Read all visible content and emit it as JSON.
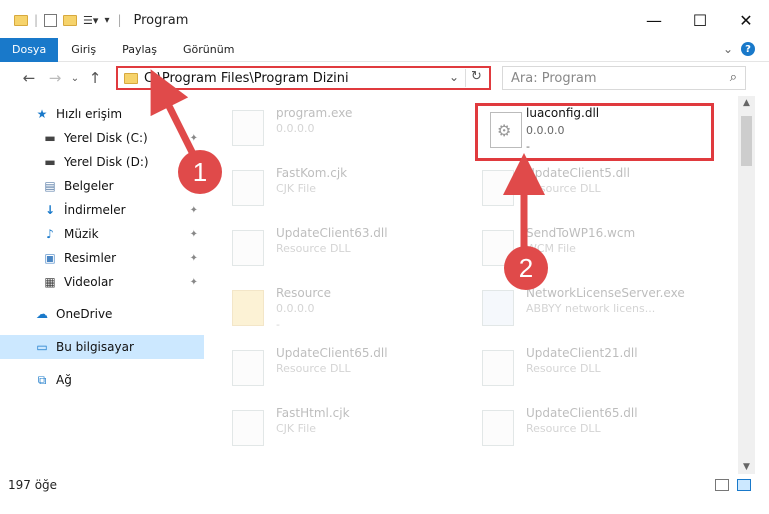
{
  "window": {
    "title": "Program",
    "minimize": "—",
    "maximize": "☐",
    "close": "✕"
  },
  "ribbon": {
    "tabs": [
      "Dosya",
      "Giriş",
      "Paylaş",
      "Görünüm"
    ],
    "expand": "⌄",
    "help": "?"
  },
  "nav": {
    "back": "←",
    "forward": "→",
    "recent": "⌄",
    "up": "↑",
    "address": "C:\\Program Files\\Program Dizini",
    "refresh": "↻",
    "search_placeholder": "Ara: Program",
    "search_icon": "🔍"
  },
  "sidebar": {
    "items": [
      {
        "label": "Hızlı erişim",
        "icon": "star-icon",
        "glyph": "★",
        "color": "#1979ca"
      },
      {
        "label": "Yerel Disk (C:)",
        "icon": "drive-icon",
        "glyph": "▬",
        "color": "#444"
      },
      {
        "label": "Yerel Disk (D:)",
        "icon": "drive-icon",
        "glyph": "▬",
        "color": "#444"
      },
      {
        "label": "Belgeler",
        "icon": "documents-icon",
        "glyph": "▤",
        "color": "#5a7ea8"
      },
      {
        "label": "İndirmeler",
        "icon": "download-icon",
        "glyph": "↓",
        "color": "#1979ca"
      },
      {
        "label": "Müzik",
        "icon": "music-icon",
        "glyph": "♪",
        "color": "#1979ca"
      },
      {
        "label": "Resimler",
        "icon": "pictures-icon",
        "glyph": "▣",
        "color": "#4a86c4"
      },
      {
        "label": "Videolar",
        "icon": "videos-icon",
        "glyph": "▦",
        "color": "#444"
      },
      {
        "label": "OneDrive",
        "icon": "cloud-icon",
        "glyph": "☁",
        "color": "#1979ca"
      },
      {
        "label": "Bu bilgisayar",
        "icon": "computer-icon",
        "glyph": "▭",
        "color": "#1979ca"
      },
      {
        "label": "Ağ",
        "icon": "network-icon",
        "glyph": "⧉",
        "color": "#1979ca"
      }
    ],
    "pin": "📌"
  },
  "files": [
    {
      "name": "program.exe",
      "type": "",
      "size": "0.0.0.0"
    },
    {
      "name": "luaconfig.dll",
      "type": "0.0.0.0",
      "size": "-"
    },
    {
      "name": "FastKom.cjk",
      "type": "CJK File",
      "size": ""
    },
    {
      "name": "UpdateClient5.dll",
      "type": "Resource DLL",
      "size": ""
    },
    {
      "name": "UpdateClient63.dll",
      "type": "Resource DLL",
      "size": ""
    },
    {
      "name": "SendToWP16.wcm",
      "type": "WCM File",
      "size": ""
    },
    {
      "name": "Resource",
      "type": "0.0.0.0",
      "size": "-"
    },
    {
      "name": "NetworkLicenseServer.exe",
      "type": "ABBYY network licens...",
      "size": ""
    },
    {
      "name": "UpdateClient65.dll",
      "type": "Resource DLL",
      "size": ""
    },
    {
      "name": "UpdateClient21.dll",
      "type": "Resource DLL",
      "size": ""
    },
    {
      "name": "FastHtml.cjk",
      "type": "CJK File",
      "size": ""
    },
    {
      "name": "UpdateClient65.dll",
      "type": "Resource DLL",
      "size": ""
    }
  ],
  "status": {
    "count": "197 öğe"
  },
  "annotations": {
    "badge1": "1",
    "badge2": "2",
    "color": "#e03a3e"
  }
}
